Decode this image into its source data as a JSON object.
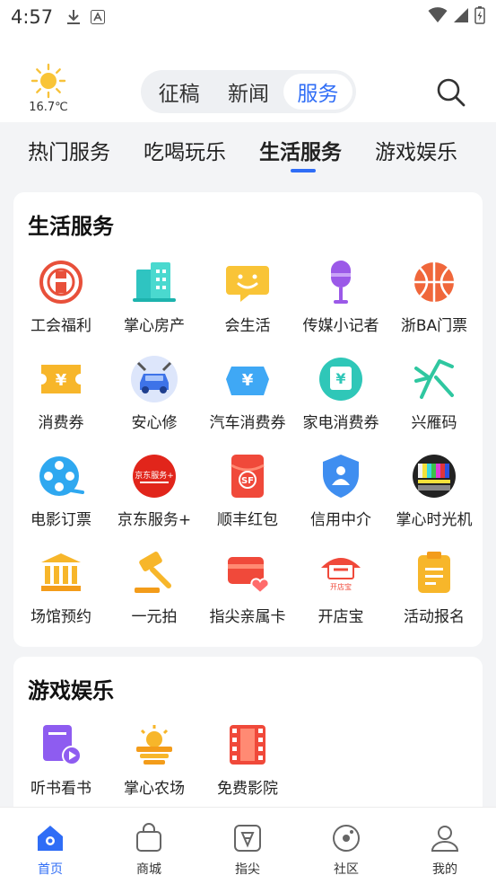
{
  "status_bar": {
    "time": "4:57"
  },
  "header": {
    "temperature": "16.7℃",
    "segments": [
      {
        "label": "征稿"
      },
      {
        "label": "新闻"
      },
      {
        "label": "服务"
      }
    ],
    "active_segment": "服务"
  },
  "category_tabs": [
    {
      "label": "热门服务"
    },
    {
      "label": "吃喝玩乐"
    },
    {
      "label": "生活服务"
    },
    {
      "label": "游戏娱乐"
    }
  ],
  "life_services": {
    "title": "生活服务",
    "items": [
      {
        "label": "工会福利",
        "icon": "union-welfare-icon"
      },
      {
        "label": "掌心房产",
        "icon": "real-estate-icon"
      },
      {
        "label": "会生活",
        "icon": "smile-bubble-icon"
      },
      {
        "label": "传媒小记者",
        "icon": "microphone-icon"
      },
      {
        "label": "浙BA门票",
        "icon": "basketball-icon"
      },
      {
        "label": "消费券",
        "icon": "coupon-icon"
      },
      {
        "label": "安心修",
        "icon": "car-repair-icon"
      },
      {
        "label": "汽车消费券",
        "icon": "car-coupon-icon"
      },
      {
        "label": "家电消费券",
        "icon": "appliance-coupon-icon"
      },
      {
        "label": "兴雁码",
        "icon": "goose-code-icon"
      },
      {
        "label": "电影订票",
        "icon": "film-reel-icon"
      },
      {
        "label": "京东服务+",
        "icon": "jd-service-icon",
        "badge": "京东服务+"
      },
      {
        "label": "顺丰红包",
        "icon": "sf-redpacket-icon",
        "badge": "SF"
      },
      {
        "label": "信用中介",
        "icon": "credit-shield-icon"
      },
      {
        "label": "掌心时光机",
        "icon": "tv-test-pattern-icon"
      },
      {
        "label": "场馆预约",
        "icon": "venue-icon"
      },
      {
        "label": "一元拍",
        "icon": "auction-hammer-icon"
      },
      {
        "label": "指尖亲属卡",
        "icon": "family-card-icon"
      },
      {
        "label": "开店宝",
        "icon": "shop-icon",
        "badge": "开店宝"
      },
      {
        "label": "活动报名",
        "icon": "clipboard-icon"
      }
    ]
  },
  "games_entertainment": {
    "title": "游戏娱乐",
    "items": [
      {
        "label": "听书看书",
        "icon": "audiobook-icon"
      },
      {
        "label": "掌心农场",
        "icon": "farm-icon"
      },
      {
        "label": "免费影院",
        "icon": "film-strip-icon"
      }
    ]
  },
  "bottom_nav": [
    {
      "label": "首页",
      "icon": "home-icon"
    },
    {
      "label": "商城",
      "icon": "shopping-bag-icon"
    },
    {
      "label": "指尖",
      "icon": "fingertip-icon"
    },
    {
      "label": "社区",
      "icon": "community-icon"
    },
    {
      "label": "我的",
      "icon": "profile-icon"
    }
  ],
  "colors": {
    "accent": "#2f6df6",
    "background": "#f3f4f6"
  }
}
